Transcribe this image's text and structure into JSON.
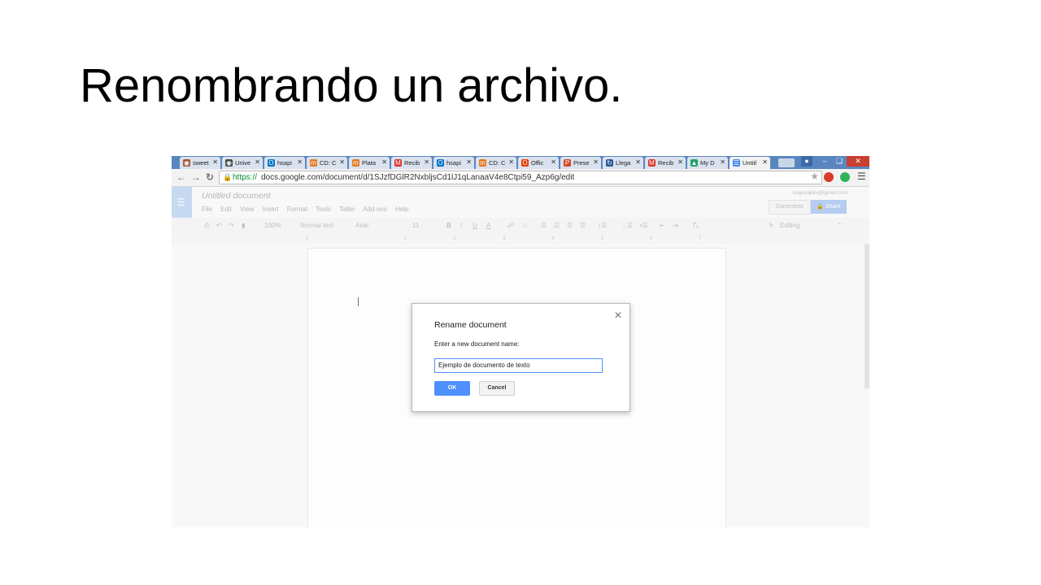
{
  "slide": {
    "title": "Renombrando un archivo."
  },
  "browser": {
    "tabs": [
      {
        "label": "sweet",
        "icon": "cake-icon",
        "color": "#a0522d"
      },
      {
        "label": "Unive",
        "icon": "eye-icon",
        "color": "#444444"
      },
      {
        "label": "hsapi",
        "icon": "outlook-icon",
        "color": "#0072c6"
      },
      {
        "label": "CD: C",
        "icon": "moodle-icon",
        "color": "#e8761f"
      },
      {
        "label": "Plata",
        "icon": "moodle-icon",
        "color": "#e8761f"
      },
      {
        "label": "Recib",
        "icon": "gmail-icon",
        "color": "#d93025"
      },
      {
        "label": "hsapi",
        "icon": "outlook-icon",
        "color": "#0072c6"
      },
      {
        "label": "CD: C",
        "icon": "moodle-icon",
        "color": "#e8761f"
      },
      {
        "label": "Offic",
        "icon": "office-icon",
        "color": "#eb3c00"
      },
      {
        "label": "Prese",
        "icon": "powerpoint-icon",
        "color": "#d24726"
      },
      {
        "label": "Llega",
        "icon": "sync-icon",
        "color": "#2b579a"
      },
      {
        "label": "Recib",
        "icon": "gmail-icon",
        "color": "#d93025"
      },
      {
        "label": "My D",
        "icon": "drive-icon",
        "color": "#1fa463"
      },
      {
        "label": "Untitl",
        "icon": "docs-icon",
        "color": "#4285f4",
        "active": true
      }
    ],
    "url_scheme": "https://",
    "url_rest": "docs.google.com/document/d/1SJzfDGlR2NxbljsCd1lJ1qLanaaV4e8Ctpi59_Azp6g/edit"
  },
  "docs": {
    "title": "Untitled document",
    "email": "hugosapier@gmail.com",
    "menu": [
      "File",
      "Edit",
      "View",
      "Insert",
      "Format",
      "Tools",
      "Table",
      "Add-ons",
      "Help"
    ],
    "comments_label": "Comments",
    "share_label": "Share",
    "toolbar": {
      "zoom": "100%",
      "style": "Normal text",
      "font": "Arial",
      "size": "11",
      "mode": "Editing"
    },
    "ruler_numbers": [
      "1",
      "1",
      "2",
      "3",
      "4",
      "5",
      "6",
      "7"
    ]
  },
  "dialog": {
    "title": "Rename document",
    "label": "Enter a new document name:",
    "input_value": "Ejemplo de documento de texto",
    "ok_label": "OK",
    "cancel_label": "Cancel"
  }
}
